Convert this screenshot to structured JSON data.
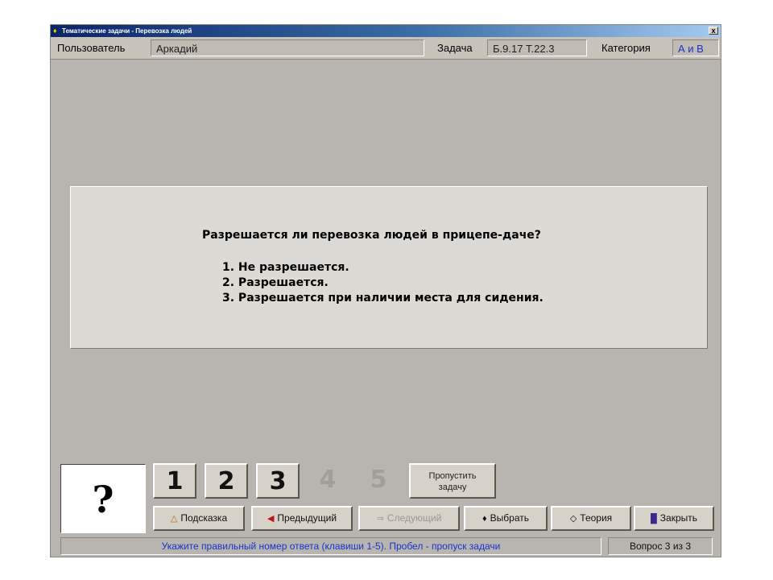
{
  "window": {
    "title": "Тематические задачи - Перевозка людей",
    "close_glyph": "x"
  },
  "infobar": {
    "user_label": "Пользователь",
    "user_value": "Аркадий",
    "task_label": "Задача",
    "task_value": "Б.9.17  Т.22.3",
    "category_label": "Категория",
    "category_value": "А и В"
  },
  "question": {
    "text": "Разрешается ли перевозка людей в прицепе-даче?",
    "answers": [
      "1. Не разрешается.",
      "2. Разрешается.",
      "3. Разрешается при наличии места для сидения."
    ]
  },
  "answer_indicator": "?",
  "answer_buttons": [
    "1",
    "2",
    "3",
    "4",
    "5"
  ],
  "skip_button": {
    "line1": "Пропустить",
    "line2": "задачу"
  },
  "actions": {
    "hint": "Подсказка",
    "previous": "Предыдущий",
    "next": "Следующий",
    "choose": "Выбрать",
    "theory": "Теория",
    "close": "Закрыть"
  },
  "icons": {
    "hint": "hint-icon",
    "previous": "arrow-left-icon",
    "next": "arrow-right-icon",
    "choose": "choose-icon",
    "theory": "theory-icon",
    "close": "door-icon"
  },
  "status": {
    "message": "Укажите правильный номер ответа (клавиши 1-5). Пробел - пропуск задачи",
    "counter": "Вопрос 3 из 3"
  },
  "colors": {
    "titlebar_start": "#0a246a",
    "window_bg": "#b8b4b0",
    "accent_blue": "#1a33cc",
    "disabled_text": "#a29e98"
  }
}
